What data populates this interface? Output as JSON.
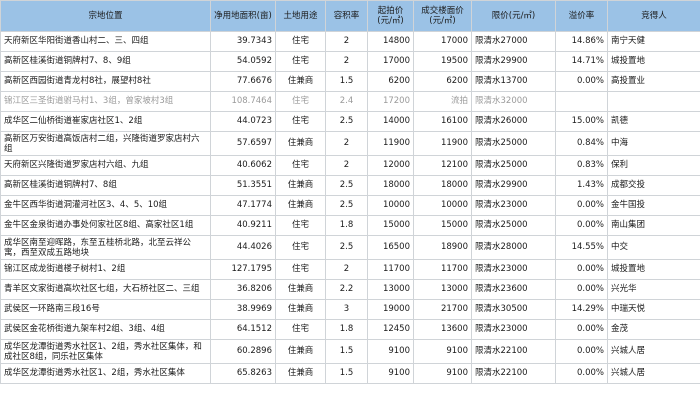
{
  "headers": [
    "宗地位置",
    "净用地面积(亩)",
    "土地用途",
    "容积率",
    "起拍价(元/㎡)",
    "成交楼面价(元/㎡)",
    "限价(元/㎡)",
    "溢价率",
    "竞得人"
  ],
  "rows": [
    {
      "location": "天府新区华阳街道香山村二、三、四组",
      "area": "39.7343",
      "use": "住宅",
      "far": "2",
      "start": "14800",
      "deal": "17000",
      "limit": "限清水27000",
      "premium": "14.86%",
      "winner": "南宁天健"
    },
    {
      "location": "高新区桂溪街道铜牌村7、8、9组",
      "area": "54.0592",
      "use": "住宅",
      "far": "2",
      "start": "17000",
      "deal": "19500",
      "limit": "限清水29900",
      "premium": "14.71%",
      "winner": "城投置地"
    },
    {
      "location": "高新区西园街道青龙村8社，展望村8社",
      "area": "77.6676",
      "use": "住兼商",
      "far": "1.5",
      "start": "6200",
      "deal": "6200",
      "limit": "限清水13700",
      "premium": "0.00%",
      "winner": "高投置业"
    },
    {
      "location": "锦江区三圣街道驸马村1、3组，曾家坡村3组",
      "area": "108.7464",
      "use": "住宅",
      "far": "2.4",
      "start": "17200",
      "deal": "流拍",
      "limit": "限清水32000",
      "premium": "",
      "winner": ""
    },
    {
      "location": "成华区二仙桥街道崔家店社区1、2组",
      "area": "44.0723",
      "use": "住宅",
      "far": "2.5",
      "start": "14000",
      "deal": "16100",
      "limit": "限清水26000",
      "premium": "15.00%",
      "winner": "凯德"
    },
    {
      "location": "高新区万安街道高饭店村二组，兴隆街道罗家店村六组",
      "area": "57.6597",
      "use": "住兼商",
      "far": "2",
      "start": "11900",
      "deal": "11900",
      "limit": "限清水25000",
      "premium": "0.84%",
      "winner": "中海"
    },
    {
      "location": "天府新区兴隆街道罗家店村六组、九组",
      "area": "40.6062",
      "use": "住宅",
      "far": "2",
      "start": "12000",
      "deal": "12100",
      "limit": "限清水25000",
      "premium": "0.83%",
      "winner": "保利"
    },
    {
      "location": "高新区桂溪街道铜牌村7、8组",
      "area": "51.3551",
      "use": "住兼商",
      "far": "2.5",
      "start": "18000",
      "deal": "18000",
      "limit": "限清水29900",
      "premium": "1.43%",
      "winner": "成都交投"
    },
    {
      "location": "金牛区西华街道洞灌河社区3、4、5、10组",
      "area": "47.1774",
      "use": "住兼商",
      "far": "2.5",
      "start": "10000",
      "deal": "10000",
      "limit": "限清水23000",
      "premium": "0.00%",
      "winner": "金牛国投"
    },
    {
      "location": "金牛区金泉街道办事处何家社区8组、高家社区1组",
      "area": "40.9211",
      "use": "住宅",
      "far": "1.8",
      "start": "15000",
      "deal": "15000",
      "limit": "限清水25000",
      "premium": "0.00%",
      "winner": "南山集团"
    },
    {
      "location": "成华区南至迎晖路，东至五桂桥北路，北至云祥公寓，西至双成五路地块",
      "area": "44.4026",
      "use": "住宅",
      "far": "2.5",
      "start": "16500",
      "deal": "18900",
      "limit": "限清水28000",
      "premium": "14.55%",
      "winner": "中交"
    },
    {
      "location": "锦江区成龙街道楼子树村1、2组",
      "area": "127.1795",
      "use": "住宅",
      "far": "2",
      "start": "11700",
      "deal": "11700",
      "limit": "限清水23000",
      "premium": "0.00%",
      "winner": "城投置地"
    },
    {
      "location": "青羊区文家街道高坎社区七组，大石桥社区二、三组",
      "area": "36.8206",
      "use": "住兼商",
      "far": "2.2",
      "start": "13000",
      "deal": "13000",
      "limit": "限清水23600",
      "premium": "0.00%",
      "winner": "兴光华"
    },
    {
      "location": "武侯区一环路南三段16号",
      "area": "38.9969",
      "use": "住兼商",
      "far": "3",
      "start": "19000",
      "deal": "21700",
      "limit": "限清水30500",
      "premium": "14.29%",
      "winner": "中瑞天悦"
    },
    {
      "location": "武侯区金花桥街道九架车村2组、3组、4组",
      "area": "64.1512",
      "use": "住宅",
      "far": "1.8",
      "start": "12450",
      "deal": "13600",
      "limit": "限清水23000",
      "premium": "0.00%",
      "winner": "金茂"
    },
    {
      "location": "成华区龙潭街道秀水社区1、2组，秀水社区集体，和成社区8组，同乐社区集体",
      "area": "60.2896",
      "use": "住兼商",
      "far": "1.5",
      "start": "9100",
      "deal": "9100",
      "limit": "限清水22100",
      "premium": "0.00%",
      "winner": "兴城人居"
    },
    {
      "location": "成华区龙潭街道秀水社区1、2组，秀水社区集体",
      "area": "65.8263",
      "use": "住兼商",
      "far": "1.5",
      "start": "9100",
      "deal": "9100",
      "limit": "限清水22100",
      "premium": "0.00%",
      "winner": "兴城人居"
    }
  ]
}
